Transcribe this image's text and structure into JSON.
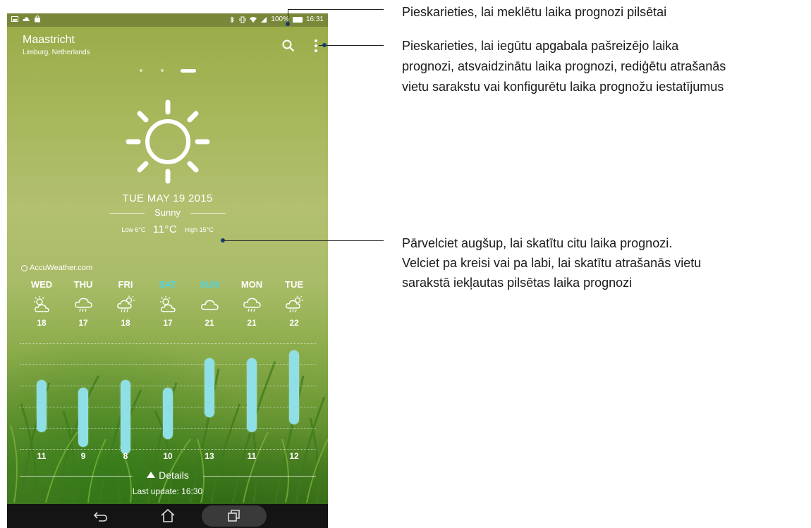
{
  "status_bar": {
    "battery": "100%",
    "time": "16:31"
  },
  "location": {
    "city": "Maastricht",
    "region": "Limburg, Netherlands"
  },
  "current": {
    "date": "TUE MAY 19 2015",
    "condition": "Sunny",
    "low": "Low 6°C",
    "temp": "11°C",
    "high": "High 15°C",
    "icon": "sun-icon"
  },
  "provider": "AccuWeather.com",
  "colors": {
    "weekend_label": "#4fd3e6",
    "temp_bar": "#8fe0e6",
    "callout_dot": "#1a3a6a"
  },
  "forecast": [
    {
      "day": "WED",
      "high": "18",
      "low": "11",
      "weekend": false,
      "icon": "partly-cloudy-day-icon"
    },
    {
      "day": "THU",
      "high": "17",
      "low": "9",
      "weekend": false,
      "icon": "rain-cloud-icon"
    },
    {
      "day": "FRI",
      "high": "18",
      "low": "8",
      "weekend": false,
      "icon": "sun-rain-cloud-icon"
    },
    {
      "day": "SAT",
      "high": "17",
      "low": "10",
      "weekend": true,
      "icon": "partly-cloudy-day-icon"
    },
    {
      "day": "SUN",
      "high": "21",
      "low": "13",
      "weekend": true,
      "icon": "cloud-icon"
    },
    {
      "day": "MON",
      "high": "21",
      "low": "11",
      "weekend": false,
      "icon": "rain-cloud-icon"
    },
    {
      "day": "TUE",
      "high": "22",
      "low": "12",
      "weekend": false,
      "icon": "sun-rain-cloud-icon"
    }
  ],
  "details_label": "Details",
  "last_update": "Last update: 16:30",
  "callouts": {
    "search": "Pieskarieties, lai meklētu laika prognozi pilsētai",
    "menu_1": "Pieskarieties, lai iegūtu apgabala pašreizējo laika",
    "menu_2": "prognozi, atsvaidzinātu laika prognozi, rediģētu atrašanās",
    "menu_3": "vietu sarakstu vai konfigurētu laika prognožu iestatījumus",
    "swipe_1": "Pārvelciet augšup, lai skatītu citu laika prognozi.",
    "swipe_2": "Velciet pa kreisi vai pa labi, lai skatītu atrašanās vietu",
    "swipe_3": "sarakstā iekļautas pilsētas laika prognozi"
  }
}
